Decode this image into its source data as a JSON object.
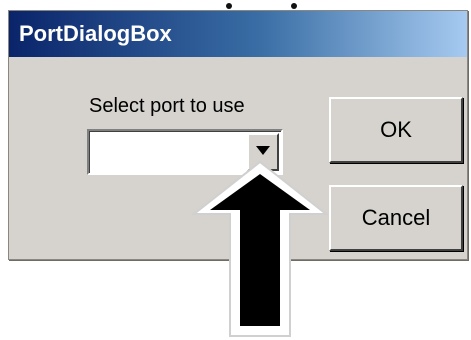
{
  "window": {
    "title": "PortDialogBox"
  },
  "form": {
    "port_label": "Select port to use",
    "port_value": ""
  },
  "buttons": {
    "ok_label": "OK",
    "cancel_label": "Cancel"
  },
  "icons": {
    "combo_dropdown": "chevron-down-icon",
    "annotation": "up-arrow-icon"
  },
  "colors": {
    "titlebar_start": "#0a246a",
    "titlebar_end": "#a6caf0",
    "dialog_face": "#d6d3ce",
    "arrow_fill": "#000000"
  }
}
